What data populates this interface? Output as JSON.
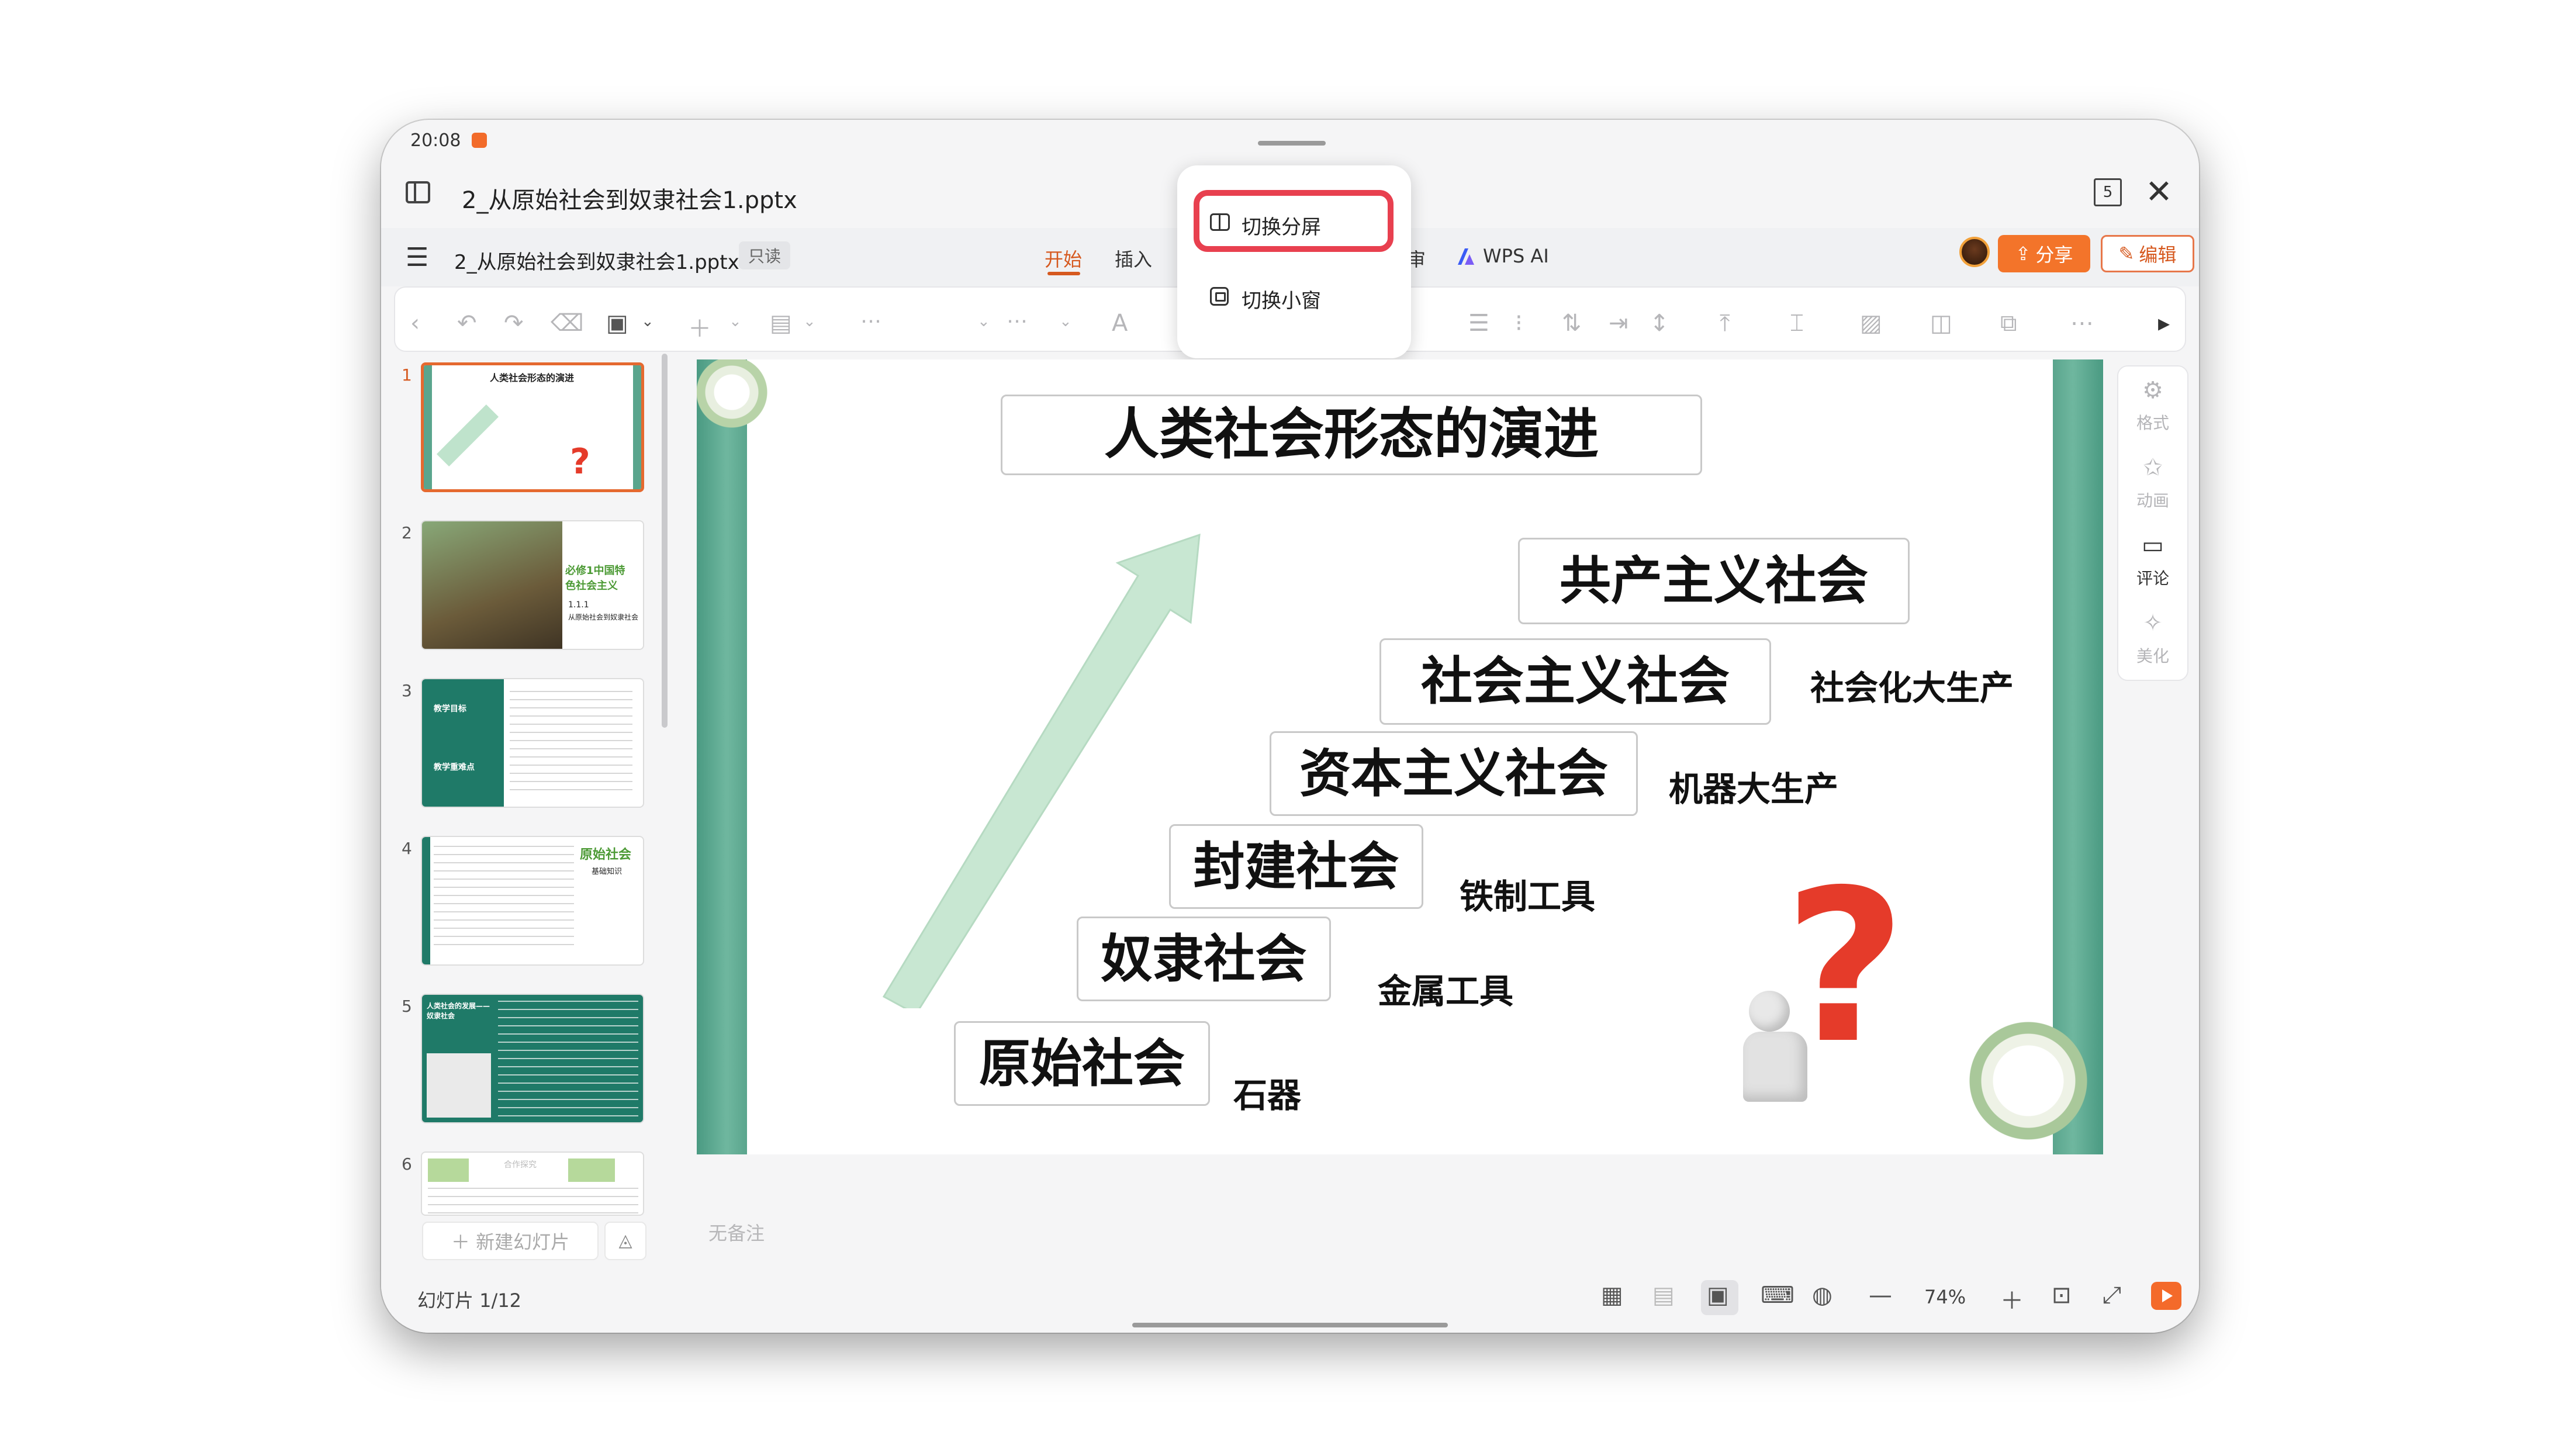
{
  "status": {
    "time": "20:08"
  },
  "window": {
    "title": "2_从原始社会到奴隶社会1.pptx",
    "window_count": "5"
  },
  "menubar": {
    "doc_name": "2_从原始社会到奴隶社会1.pptx",
    "readonly": "只读",
    "tabs": [
      "开始",
      "插入",
      "审",
      "WPS AI"
    ],
    "share": "分享",
    "edit": "编辑"
  },
  "popup": {
    "split_screen": "切换分屏",
    "small_window": "切换小窗"
  },
  "thumbnails": [
    {
      "num": "1",
      "title": "人类社会形态的演进"
    },
    {
      "num": "2",
      "text": "必修1中国特色社会主义",
      "sub": "1.1.1",
      "sub2": "从原始社会到奴隶社会"
    },
    {
      "num": "3",
      "a": "教学目标",
      "b": "教学重难点"
    },
    {
      "num": "4",
      "title": "原始社会",
      "sub": "基础知识"
    },
    {
      "num": "5",
      "title": "人类社会的发展——奴隶社会"
    },
    {
      "num": "6",
      "title": "合作探究"
    }
  ],
  "new_slide": "新建幻灯片",
  "slide": {
    "title": "人类社会形态的演进",
    "societies": [
      "共产主义社会",
      "社会主义社会",
      "资本主义社会",
      "封建社会",
      "奴隶社会",
      "原始社会"
    ],
    "productivity": [
      "社会化大生产",
      "机器大生产",
      "铁制工具",
      "金属工具",
      "石器"
    ]
  },
  "notes_placeholder": "无备注",
  "right_panel": [
    "格式",
    "动画",
    "评论",
    "美化"
  ],
  "statusbar": {
    "slide_count": "幻灯片 1/12",
    "zoom": "74%"
  },
  "colors": {
    "accent": "#d6591f",
    "highlight": "#e8404f",
    "slide_border": "#5aa58d"
  },
  "icons": [
    "side-panel-icon",
    "close-icon",
    "hamburger-icon",
    "undo-icon",
    "redo-icon",
    "play-icon",
    "question-mark-icon"
  ]
}
